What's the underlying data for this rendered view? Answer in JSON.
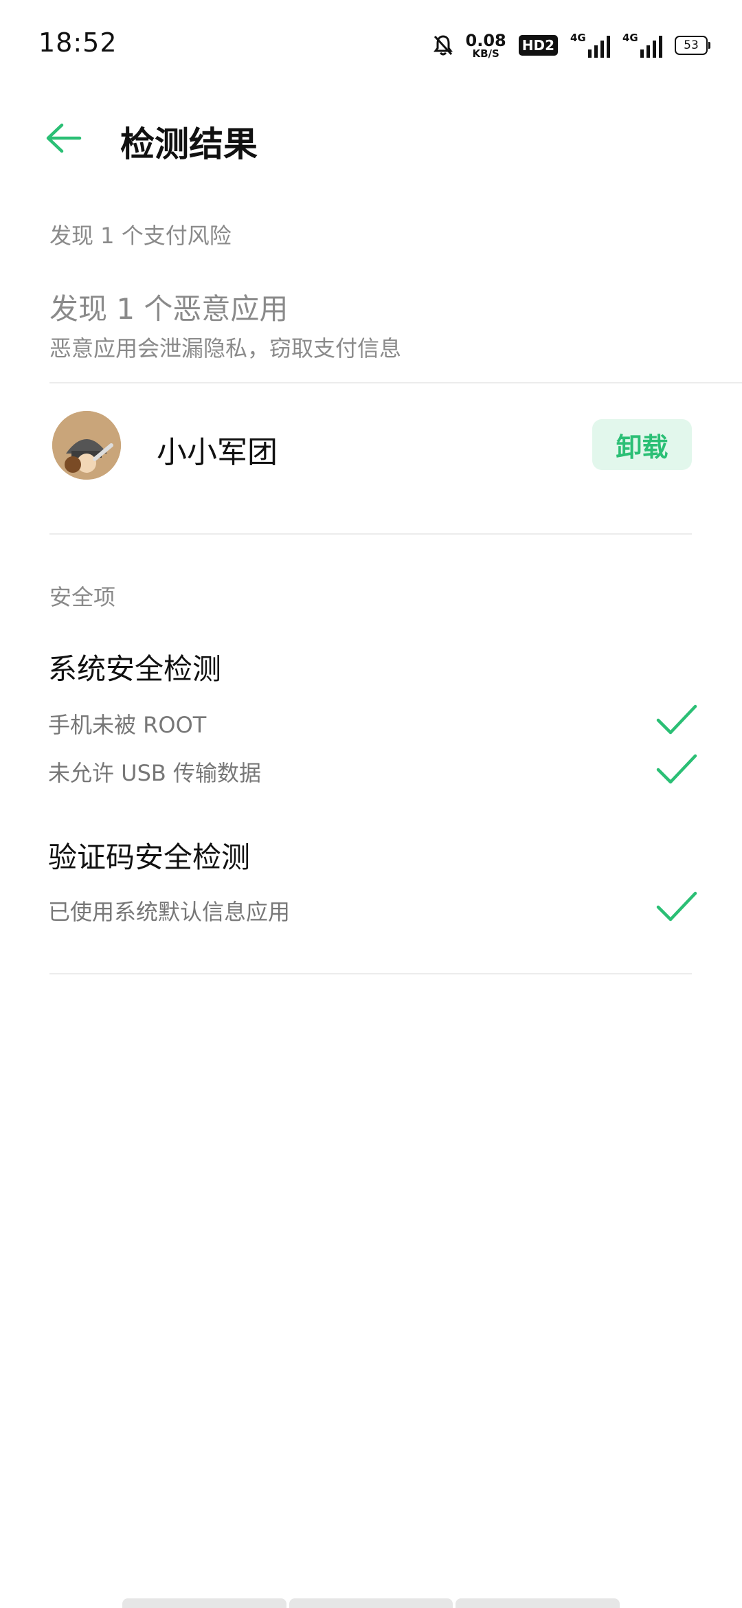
{
  "status_bar": {
    "time": "18:52",
    "net_speed_value": "0.08",
    "net_speed_unit": "KB/S",
    "hd_badge": "HD2",
    "signal1_label": "4G",
    "signal2_label": "4G",
    "battery_level": "53"
  },
  "header": {
    "title": "检测结果"
  },
  "payment_risk": {
    "section_label": "发现 1 个支付风险",
    "headline": "发现 1 个恶意应用",
    "description": "恶意应用会泄漏隐私，窃取支付信息",
    "app": {
      "name": "小小军团",
      "action_label": "卸载"
    }
  },
  "safety": {
    "section_label": "安全项",
    "groups": [
      {
        "title": "系统安全检测",
        "items": [
          "手机未被 ROOT",
          "未允许 USB 传输数据"
        ]
      },
      {
        "title": "验证码安全检测",
        "items": [
          "已使用系统默认信息应用"
        ]
      }
    ]
  },
  "colors": {
    "accent": "#2bbf75",
    "button_bg": "#e2f7ec",
    "secondary_text": "#8a8a8a",
    "divider": "#ececec"
  },
  "icons": {
    "back": "arrow-left-icon",
    "check": "check-icon",
    "mute": "bell-off-icon"
  }
}
